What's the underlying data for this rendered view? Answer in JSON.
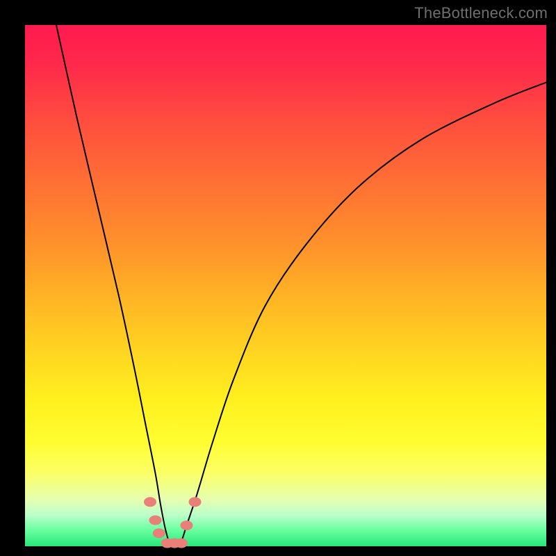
{
  "watermark": "TheBottleneck.com",
  "colors": {
    "frame": "#000000",
    "curve": "#000000",
    "marker": "#e88079",
    "gradient_stops": [
      "#ff1a4f",
      "#ff2a4a",
      "#ff4c3f",
      "#ff6f34",
      "#ff912b",
      "#ffb325",
      "#ffd321",
      "#fff01f",
      "#fffd30",
      "#fbff66",
      "#e6ffb0",
      "#bcffca",
      "#67ff9f",
      "#27e77a"
    ]
  },
  "chart_data": {
    "type": "line",
    "title": "",
    "xlabel": "",
    "ylabel": "",
    "xlim": [
      0,
      100
    ],
    "ylim": [
      0,
      100
    ],
    "grid": false,
    "legend": false,
    "note": "Axes are unitless percentage of plot area; values estimated from pixels. Curve is a V/U-shaped bottleneck profile touching ~0 near x≈26–30.",
    "series": [
      {
        "name": "bottleneck-curve",
        "x": [
          6,
          10,
          14,
          18,
          21,
          23,
          25,
          26,
          27,
          28,
          29,
          30,
          31,
          33,
          36,
          40,
          46,
          54,
          64,
          76,
          90,
          100
        ],
        "y": [
          100,
          82,
          65,
          48,
          34,
          24,
          14,
          8,
          3,
          0,
          0,
          1,
          4,
          10,
          20,
          32,
          46,
          58,
          69,
          78,
          85,
          89
        ]
      }
    ],
    "markers": {
      "name": "highlight-dots",
      "x": [
        24.0,
        25.0,
        25.7,
        27.3,
        28.7,
        30.0,
        31.0,
        32.6
      ],
      "y": [
        8.5,
        5.0,
        2.5,
        0.6,
        0.6,
        0.6,
        4.0,
        8.5
      ]
    }
  }
}
